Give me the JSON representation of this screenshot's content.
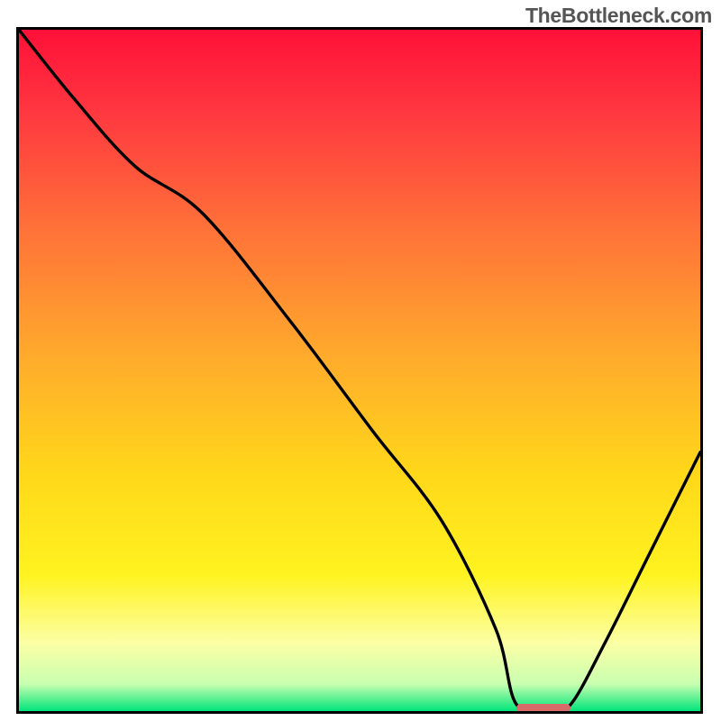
{
  "watermark": "TheBottleneck.com",
  "colors": {
    "gradient_stops": [
      {
        "offset": "0%",
        "color": "#ff1038"
      },
      {
        "offset": "12%",
        "color": "#ff3740"
      },
      {
        "offset": "30%",
        "color": "#ff7438"
      },
      {
        "offset": "48%",
        "color": "#ffab2c"
      },
      {
        "offset": "65%",
        "color": "#ffd71a"
      },
      {
        "offset": "80%",
        "color": "#fff320"
      },
      {
        "offset": "90%",
        "color": "#fcffa5"
      },
      {
        "offset": "96%",
        "color": "#c9ffb0"
      },
      {
        "offset": "100%",
        "color": "#00e57a"
      }
    ],
    "curve_stroke": "#000000",
    "marker_fill": "#d96a6a"
  },
  "chart_data": {
    "type": "line",
    "title": "",
    "xlabel": "",
    "ylabel": "",
    "xlim": [
      0,
      100
    ],
    "ylim": [
      0,
      100
    ],
    "grid": false,
    "legend": false,
    "marker": {
      "x_start": 73,
      "x_end": 81,
      "y": 0.5
    },
    "series": [
      {
        "name": "bottleneck-curve",
        "x": [
          0,
          8,
          17,
          27,
          40,
          52,
          62,
          70,
          73,
          78,
          81,
          86,
          92,
          100
        ],
        "values": [
          100,
          90,
          80,
          73,
          57,
          41,
          28,
          12,
          1,
          0.5,
          1,
          10,
          22,
          38
        ]
      }
    ]
  }
}
